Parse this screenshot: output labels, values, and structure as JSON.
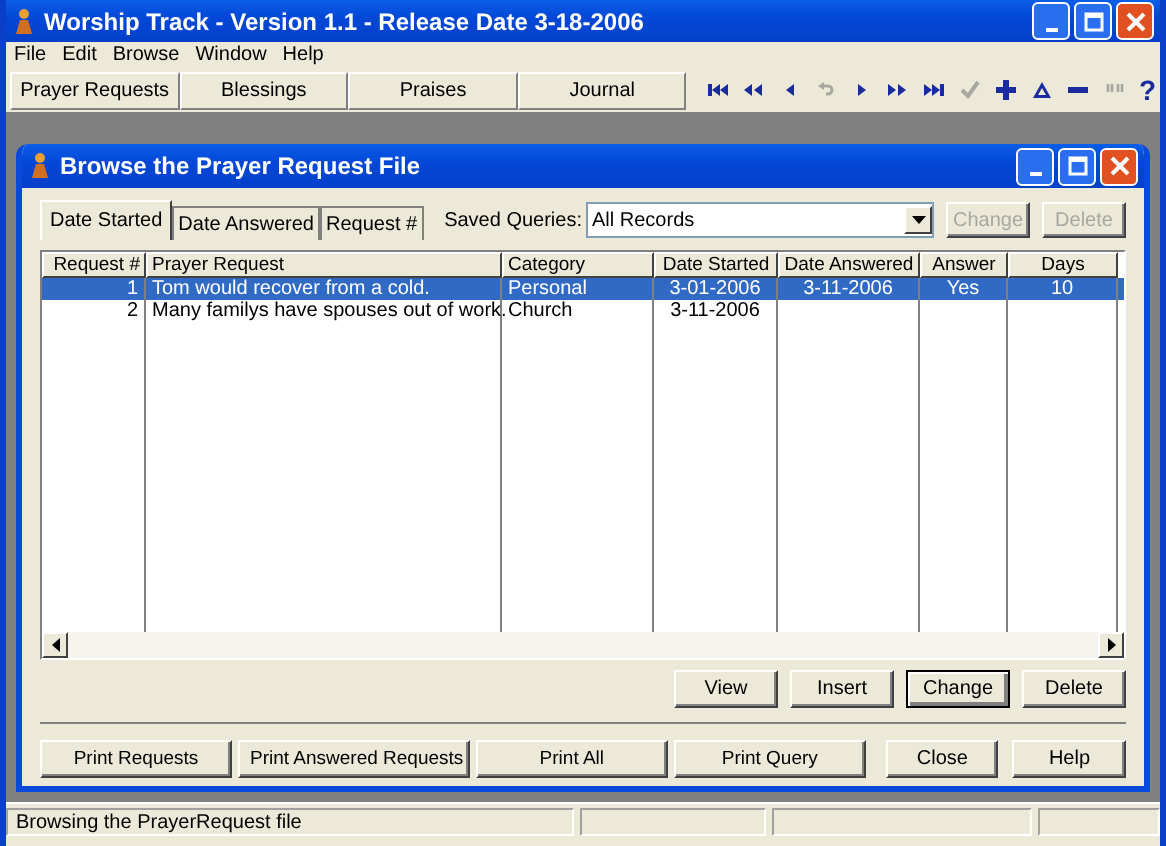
{
  "window": {
    "title": "Worship Track - Version 1.1 - Release Date 3-18-2006"
  },
  "menu": [
    "File",
    "Edit",
    "Browse",
    "Window",
    "Help"
  ],
  "toolbar": {
    "sections": [
      "Prayer Requests",
      "Blessings",
      "Praises",
      "Journal"
    ],
    "icons": [
      {
        "kind": "first",
        "disabled": false
      },
      {
        "kind": "prev-page",
        "disabled": false
      },
      {
        "kind": "prev",
        "disabled": false
      },
      {
        "kind": "undo",
        "disabled": true
      },
      {
        "kind": "next",
        "disabled": false
      },
      {
        "kind": "next-page",
        "disabled": false
      },
      {
        "kind": "last",
        "disabled": false
      },
      {
        "kind": "check",
        "disabled": true
      },
      {
        "kind": "plus",
        "disabled": false
      },
      {
        "kind": "triangle",
        "disabled": false
      },
      {
        "kind": "minus",
        "disabled": false
      },
      {
        "kind": "quote",
        "disabled": true
      }
    ],
    "help": "?"
  },
  "child": {
    "title": "Browse the Prayer Request File",
    "tabs": [
      {
        "label": "Date Started",
        "selected": true
      },
      {
        "label": "Date Answered",
        "selected": false
      },
      {
        "label": "Request #",
        "selected": false
      }
    ],
    "saved_queries": {
      "label": "Saved Queries:",
      "value": "All Records"
    },
    "query_buttons": [
      {
        "label": "Change",
        "disabled": true
      },
      {
        "label": "Delete",
        "disabled": true
      }
    ],
    "table": {
      "columns": [
        "Request #",
        "Prayer Request",
        "Category",
        "Date Started",
        "Date Answered",
        "Answer",
        "Days"
      ],
      "rows": [
        {
          "selected": true,
          "cells": [
            "1",
            "Tom would recover from a cold.",
            "Personal",
            "3-01-2006",
            "3-11-2006",
            "Yes",
            "10"
          ]
        },
        {
          "selected": false,
          "cells": [
            "2",
            "Many familys have spouses out of work.",
            "Church",
            "3-11-2006",
            "",
            "",
            ""
          ]
        }
      ]
    },
    "record_buttons": [
      {
        "label": "View",
        "default": false
      },
      {
        "label": "Insert",
        "default": false
      },
      {
        "label": "Change",
        "default": true
      },
      {
        "label": "Delete",
        "default": false
      }
    ],
    "print_buttons": [
      "Print Requests",
      "Print Answered Requests",
      "Print All",
      "Print Query"
    ],
    "dialog_buttons": [
      "Close",
      "Help"
    ]
  },
  "status_bar": {
    "text": "Browsing the PrayerRequest file"
  }
}
